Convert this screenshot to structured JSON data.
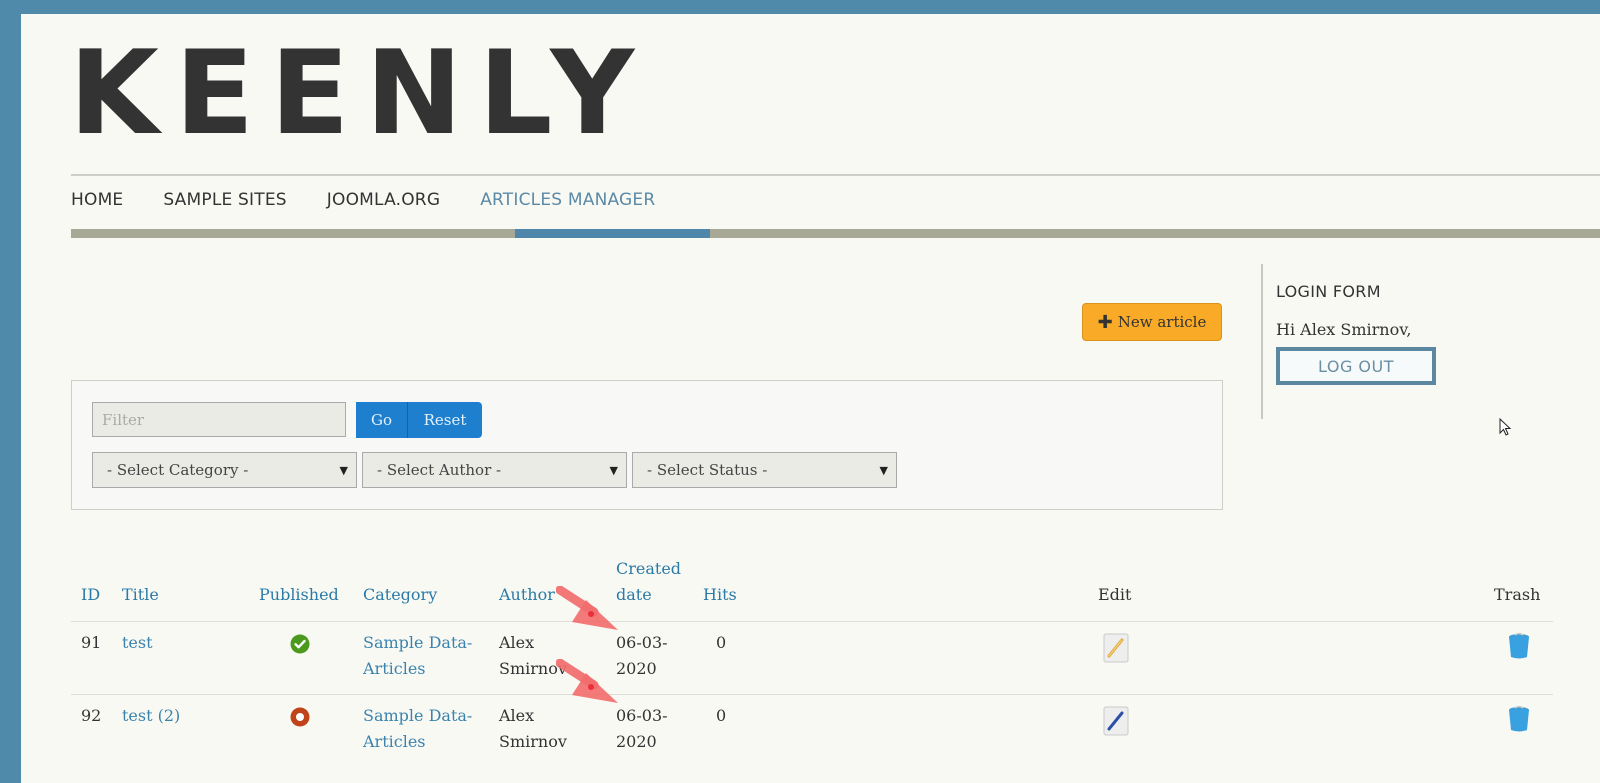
{
  "site": {
    "logo": "KEENLY"
  },
  "nav": {
    "items": [
      {
        "label": "HOME",
        "active": false
      },
      {
        "label": "SAMPLE SITES",
        "active": false
      },
      {
        "label": "JOOMLA.ORG",
        "active": false
      },
      {
        "label": "ARTICLES MANAGER",
        "active": true
      }
    ]
  },
  "toolbar": {
    "new_article_label": "New article",
    "new_article_icon": "plus-icon"
  },
  "filters": {
    "filter_placeholder": "Filter",
    "filter_value": "",
    "go_label": "Go",
    "reset_label": "Reset",
    "category_select": "- Select Category -",
    "author_select": "- Select Author -",
    "status_select": "- Select Status -"
  },
  "login": {
    "title": "LOGIN FORM",
    "greeting": "Hi Alex Smirnov,",
    "logout_label": "LOG OUT"
  },
  "table": {
    "headers": {
      "id": "ID",
      "title": "Title",
      "published": "Published",
      "category": "Category",
      "author": "Author",
      "created_line1": "Created",
      "created_line2": "date",
      "hits": "Hits",
      "edit": "Edit",
      "trash": "Trash"
    },
    "rows": [
      {
        "id": "91",
        "title": "test",
        "published": "published",
        "category_line1": "Sample Data-",
        "category_line2": "Articles",
        "author_line1": "Alex",
        "author_line2": "Smirnov",
        "created_line1": "06-03-",
        "created_line2": "2020",
        "hits": "0",
        "edit_icon": "pencil-icon",
        "trash_icon": "trash-icon"
      },
      {
        "id": "92",
        "title": "test (2)",
        "published": "unpublished",
        "category_line1": "Sample Data-",
        "category_line2": "Articles",
        "author_line1": "Alex",
        "author_line2": "Smirnov",
        "created_line1": "06-03-",
        "created_line2": "2020",
        "hits": "0",
        "edit_icon": "pen-icon",
        "trash_icon": "trash-icon"
      }
    ]
  },
  "colors": {
    "frame": "#4f8aab",
    "accent": "#4f86a9",
    "link": "#2a7aa6",
    "new_article_bg": "#f9aa26",
    "go_reset_bg": "#1e7fce",
    "published_green": "#4b9a1e",
    "unpublished_red": "#c0431a",
    "annotation_arrow": "#f26b6b"
  }
}
